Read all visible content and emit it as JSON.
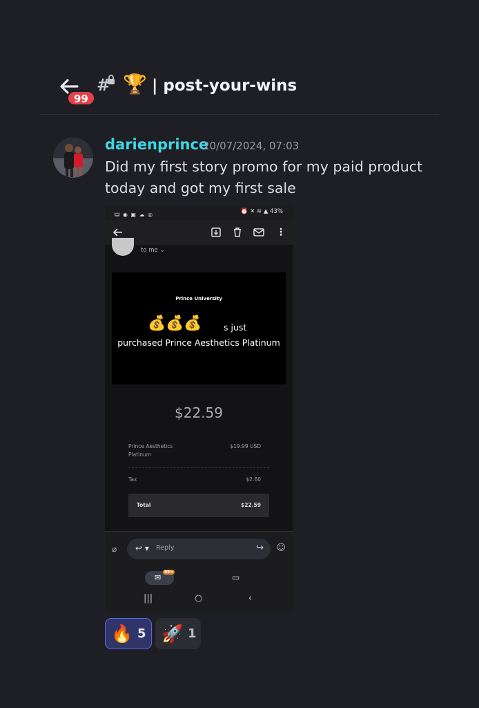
{
  "header": {
    "unread_badge": "99",
    "channel_hash": "#",
    "channel_emoji": "🏆",
    "channel_name": "| post-your-wins"
  },
  "message": {
    "username": "darienprince",
    "timestamp": "20/07/2024, 07:03",
    "text": "Did my first story promo for my paid product today and got my first sale",
    "username_color": "#3fd6e4"
  },
  "attachment": {
    "status_left": "🜲 ◉ ▣ ☁ ◎",
    "status_right": "⏰ ✕ ≋ ▲ 43%",
    "to_me": "to me ⌄",
    "brand": "Prince University",
    "emojis": "💰💰💰",
    "headline_tail": "s just",
    "headline_rest": "purchased Prince Aesthetics Platinum",
    "total_big": "$22.59",
    "items": [
      {
        "label": "Prince Aesthetics Platinum",
        "amount": "$19.99 USD"
      },
      {
        "label": "Tax",
        "amount": "$2.60"
      },
      {
        "label": "Total",
        "amount": "$22.59"
      }
    ],
    "reply_placeholder": "Reply",
    "mail_badge": "99+"
  },
  "reactions": [
    {
      "emoji": "🔥",
      "count": "5",
      "active": true
    },
    {
      "emoji": "🚀",
      "count": "1",
      "active": false
    }
  ],
  "colors": {
    "background": "#1e1f24",
    "badge_red": "#e5404a",
    "accent": "#5865f2"
  }
}
